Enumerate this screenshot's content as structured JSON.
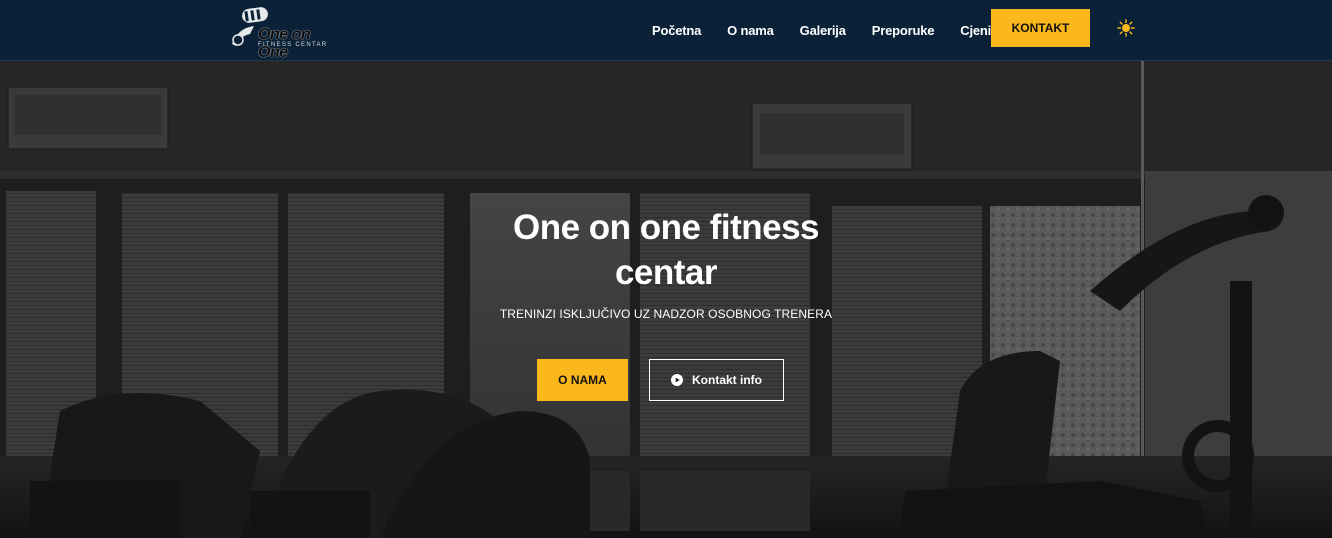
{
  "header": {
    "logo_name": "One on One",
    "logo_sub": "FITNESS CENTAR",
    "nav": [
      "Početna",
      "O nama",
      "Galerija",
      "Preporuke",
      "Cjenik"
    ],
    "cta_label": "KONTAKT",
    "theme_icon": "sun-icon"
  },
  "hero": {
    "title": "One on one fitness centar",
    "subtitle": "TRENINZI ISKLJUČIVO UZ NADZOR OSOBNOG TRENERA",
    "primary_button": "O NAMA",
    "secondary_button": "Kontakt info",
    "secondary_icon": "play-circle-icon",
    "background_image": "grayscale gym interior with windows and weight machines"
  },
  "colors": {
    "header_bg": "#0b2138",
    "accent": "#fbb81d",
    "text": "#ffffff"
  }
}
